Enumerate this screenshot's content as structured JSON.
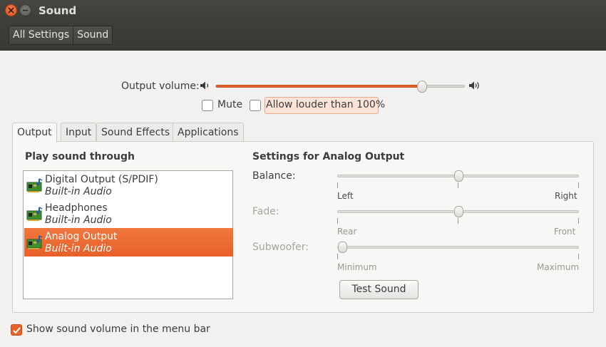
{
  "window": {
    "title": "Sound"
  },
  "toolbar": {
    "crumbs": [
      "All Settings",
      "Sound"
    ]
  },
  "output_volume": {
    "label": "Output volume:",
    "level": 0.83
  },
  "options": {
    "mute_label": "Mute",
    "mute_checked": false,
    "louder_label": "Allow louder than 100%",
    "louder_checked": false
  },
  "tabs": [
    "Output",
    "Input",
    "Sound Effects",
    "Applications"
  ],
  "active_tab": "Output",
  "output": {
    "list_heading": "Play sound through",
    "devices": [
      {
        "name": "Digital Output (S/PDIF)",
        "sub": "Built-in Audio",
        "selected": false
      },
      {
        "name": "Headphones",
        "sub": "Built-in Audio",
        "selected": false
      },
      {
        "name": "Analog Output",
        "sub": "Built-in Audio",
        "selected": true
      }
    ],
    "settings_heading": "Settings for Analog Output",
    "balance": {
      "label": "Balance:",
      "left": "Left",
      "right": "Right",
      "value": 0.5
    },
    "fade": {
      "label": "Fade:",
      "left": "Rear",
      "right": "Front",
      "value": 0.5
    },
    "subwoofer": {
      "label": "Subwoofer:",
      "left": "Minimum",
      "right": "Maximum",
      "value": 0.0
    },
    "test_button": "Test Sound"
  },
  "menubar_option": {
    "label": "Show sound volume in the menu bar",
    "checked": true
  },
  "colors": {
    "accent": "#e8602a",
    "titlebar": "#3d3c38"
  }
}
